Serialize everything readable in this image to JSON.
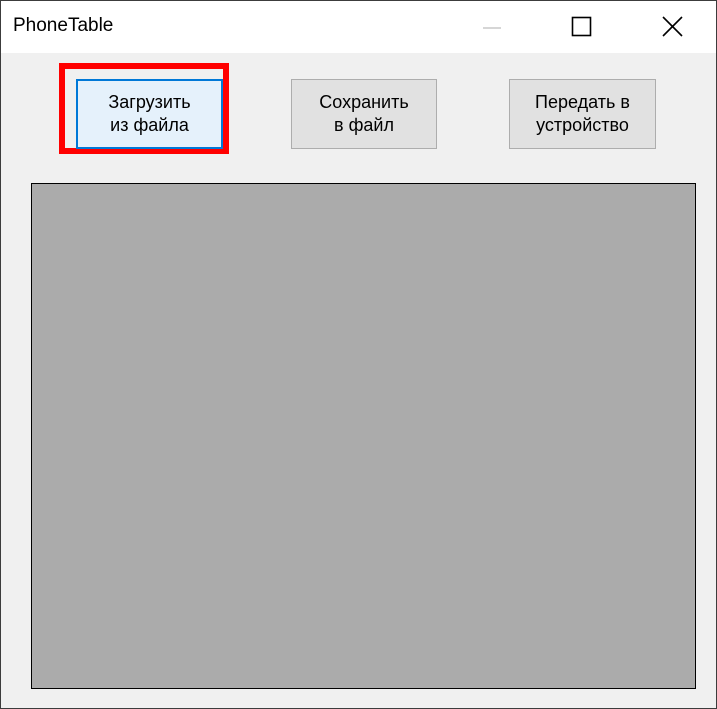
{
  "window": {
    "title": "PhoneTable",
    "controls": {
      "minimize_icon": "minimize-icon",
      "maximize_icon": "maximize-icon",
      "close_icon": "close-icon"
    }
  },
  "toolbar": {
    "load_label": "Загрузить\nиз файла",
    "save_label": "Сохранить\nв файл",
    "send_label": "Передать в\nустройство"
  },
  "colors": {
    "highlight": "#ff0000",
    "focus_border": "#0078d7",
    "button_face": "#e1e1e1",
    "window_bg": "#f0f0f0",
    "grid_bg": "#ababab"
  }
}
